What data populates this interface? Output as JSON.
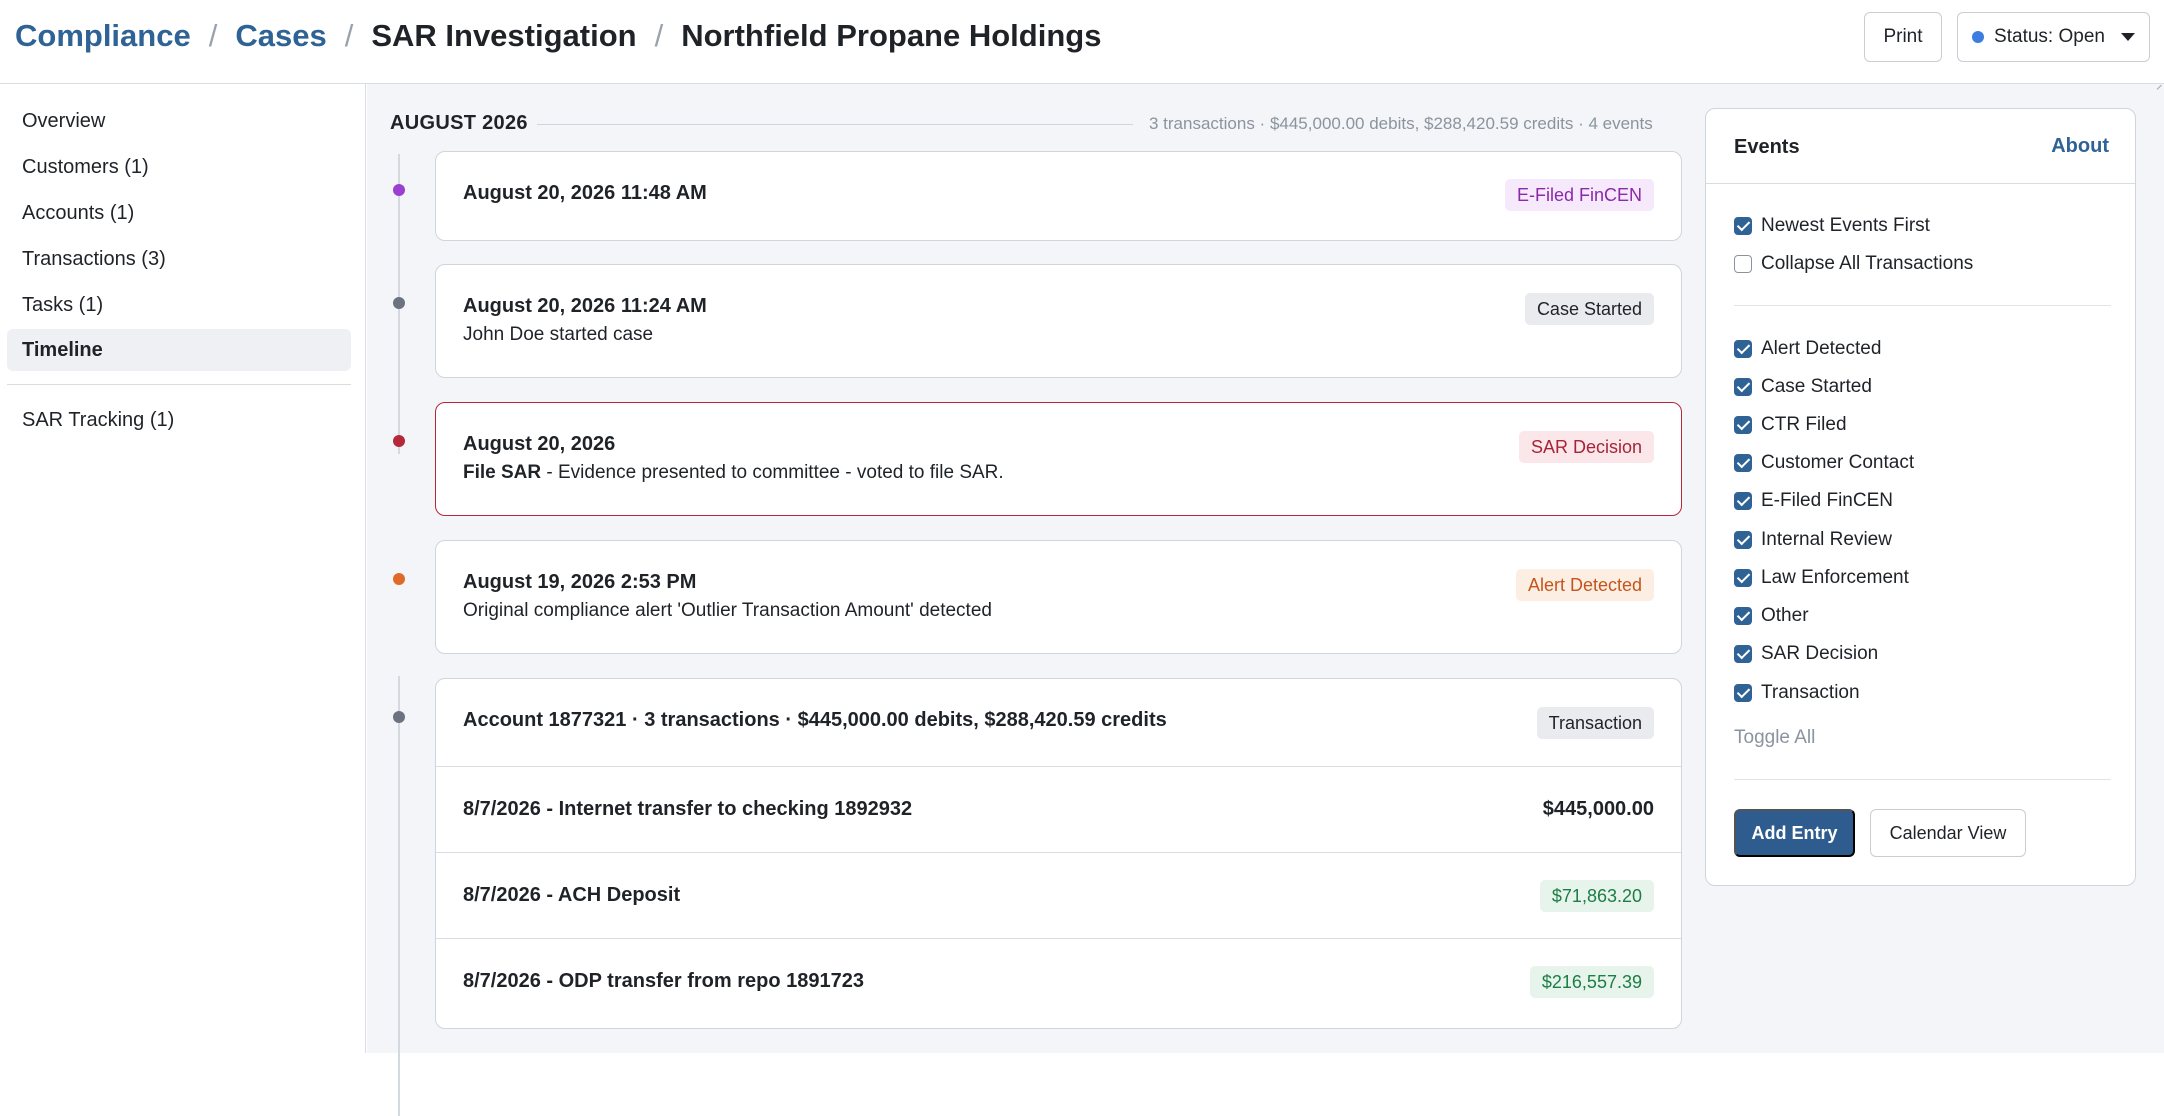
{
  "breadcrumb": {
    "items": [
      "Compliance",
      "Cases",
      "SAR Investigation",
      "Northfield Propane Holdings"
    ],
    "separator": "/"
  },
  "header": {
    "print_label": "Print",
    "status_label": "Status: Open",
    "status_color": "#3b7de0"
  },
  "sidebar": {
    "items": [
      {
        "label": "Overview"
      },
      {
        "label": "Customers (1)"
      },
      {
        "label": "Accounts (1)"
      },
      {
        "label": "Transactions (3)"
      },
      {
        "label": "Tasks (1)"
      },
      {
        "label": "Timeline",
        "active": true
      },
      {
        "label": "SAR Tracking (1)"
      }
    ]
  },
  "timeline": {
    "month": "AUGUST 2026",
    "summary": "3 transactions · $445,000.00 debits, $288,420.59 credits · 4 events",
    "events": [
      {
        "title": "August 20, 2026 11:48 AM",
        "badge": "E-Filed FinCEN",
        "dot_color": "#9b3fd1"
      },
      {
        "title": "August 20, 2026 11:24 AM",
        "description": "John Doe started case",
        "badge": "Case Started",
        "dot_color": "#6b7280"
      },
      {
        "title": "August 20, 2026",
        "description_bold": "File SAR",
        "description": " - Evidence presented to committee - voted to file SAR.",
        "badge": "SAR Decision",
        "dot_color": "#b5283a"
      },
      {
        "title": "August 19, 2026 2:53 PM",
        "description": "Original compliance alert 'Outlier Transaction Amount' detected",
        "badge": "Alert Detected",
        "dot_color": "#e0692a"
      }
    ],
    "transaction_group": {
      "title": "Account 1877321 · 3 transactions · $445,000.00 debits, $288,420.59 credits",
      "badge": "Transaction",
      "dot_color": "#6b7280",
      "rows": [
        {
          "label": "8/7/2026 - Internet transfer to checking 1892932",
          "amount": "$445,000.00",
          "type": "debit"
        },
        {
          "label": "8/7/2026 - ACH Deposit",
          "amount": "$71,863.20",
          "type": "credit"
        },
        {
          "label": "8/7/2026 - ODP transfer from repo 1891723",
          "amount": "$216,557.39",
          "type": "credit"
        }
      ]
    }
  },
  "events_panel": {
    "title": "Events",
    "about_label": "About",
    "options": [
      {
        "label": "Newest Events First",
        "checked": true
      },
      {
        "label": "Collapse All Transactions",
        "checked": false
      }
    ],
    "filters": [
      {
        "label": "Alert Detected",
        "checked": true
      },
      {
        "label": "Case Started",
        "checked": true
      },
      {
        "label": "CTR Filed",
        "checked": true
      },
      {
        "label": "Customer Contact",
        "checked": true
      },
      {
        "label": "E-Filed FinCEN",
        "checked": true
      },
      {
        "label": "Internal Review",
        "checked": true
      },
      {
        "label": "Law Enforcement",
        "checked": true
      },
      {
        "label": "Other",
        "checked": true
      },
      {
        "label": "SAR Decision",
        "checked": true
      },
      {
        "label": "Transaction",
        "checked": true
      }
    ],
    "toggle_all_label": "Toggle All",
    "add_entry_label": "Add Entry",
    "calendar_view_label": "Calendar View"
  }
}
